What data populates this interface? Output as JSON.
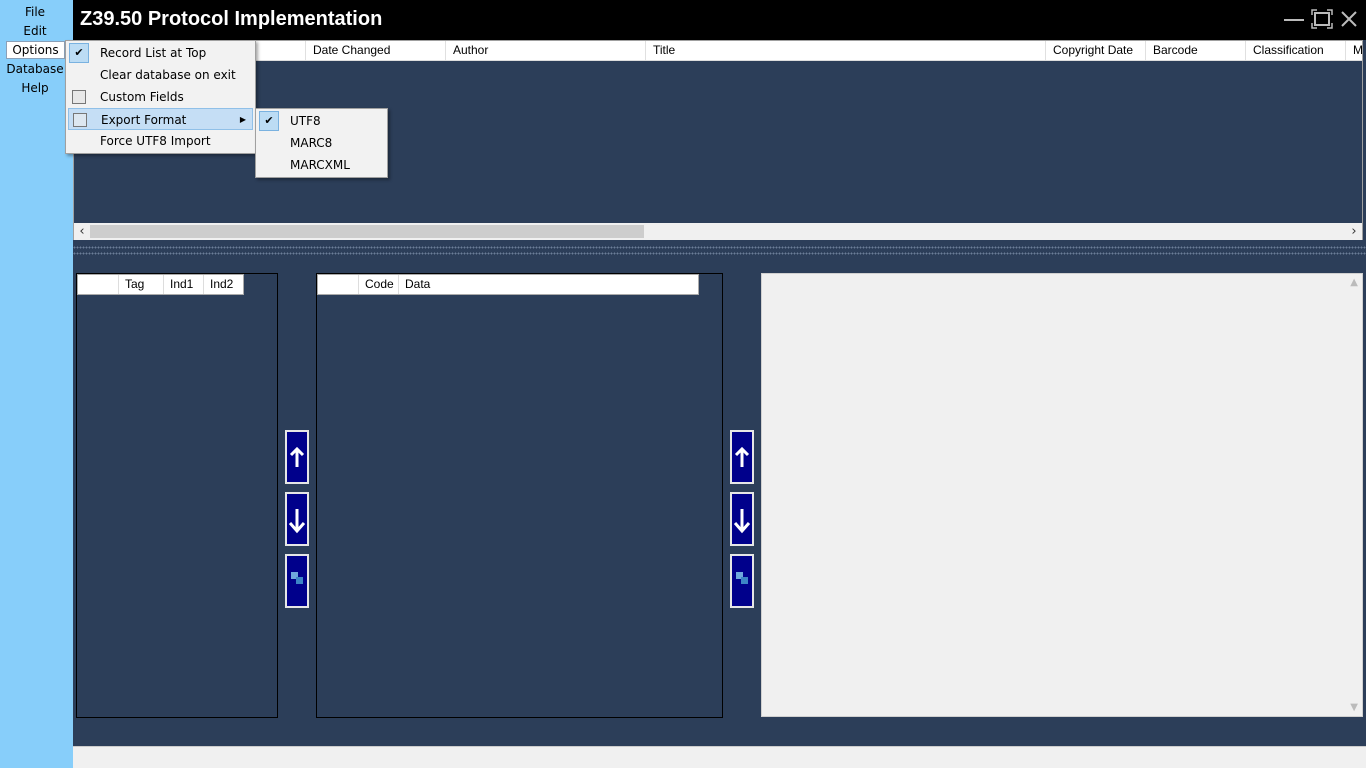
{
  "window": {
    "title": "Z39.50 Protocol Implementation"
  },
  "menubar": {
    "file": "File",
    "edit": "Edit",
    "options": "Options",
    "database": "Database",
    "help": "Help"
  },
  "options_menu": {
    "record_list_at_top": "Record List at Top",
    "clear_database_on_exit": "Clear database on exit",
    "custom_fields": "Custom Fields",
    "export_format": "Export Format",
    "force_utf8_import": "Force UTF8 Import"
  },
  "export_submenu": {
    "utf8": "UTF8",
    "marc8": "MARC8",
    "marcxml": "MARCXML"
  },
  "record_grid": {
    "columns": [
      "Date Changed",
      "Author",
      "Title",
      "Copyright Date",
      "Barcode",
      "Classification",
      "Ma"
    ]
  },
  "field_grid": {
    "columns": [
      "Tag",
      "Ind1",
      "Ind2"
    ]
  },
  "subfield_grid": {
    "columns": [
      "Code",
      "Data"
    ]
  },
  "icons": {
    "check": "✔",
    "up": "arrow-up-icon",
    "down": "arrow-down-icon",
    "swap": "swap-icon"
  },
  "colors": {
    "accent": "#87cefa",
    "background": "#2c3e59",
    "button": "#00008b",
    "titlebar": "#000000"
  }
}
